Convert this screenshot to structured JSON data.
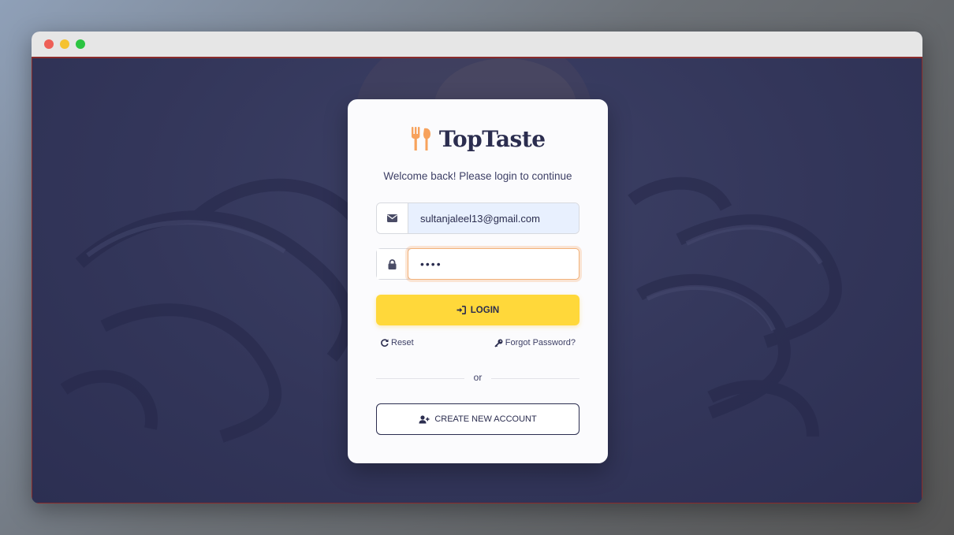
{
  "brand": {
    "name": "TopTaste",
    "accent": "#f7a25c"
  },
  "login": {
    "welcome": "Welcome back! Please login to continue",
    "email_value": "sultanjaleel13@gmail.com",
    "password_value": "••••",
    "login_label": "LOGIN",
    "reset_label": "Reset",
    "forgot_label": "Forgot Password?",
    "or_label": "or",
    "create_label": "CREATE NEW ACCOUNT"
  },
  "icons": {
    "brand": "utensils-icon",
    "email": "envelope-icon",
    "password": "lock-icon",
    "login": "sign-in-icon",
    "reset": "redo-icon",
    "forgot": "key-icon",
    "create": "user-plus-icon"
  },
  "colors": {
    "primary_button": "#ffd83a",
    "text_dark": "#2b2d4f",
    "email_fill": "#e8f0fe",
    "focus_ring": "#f2b27a"
  }
}
